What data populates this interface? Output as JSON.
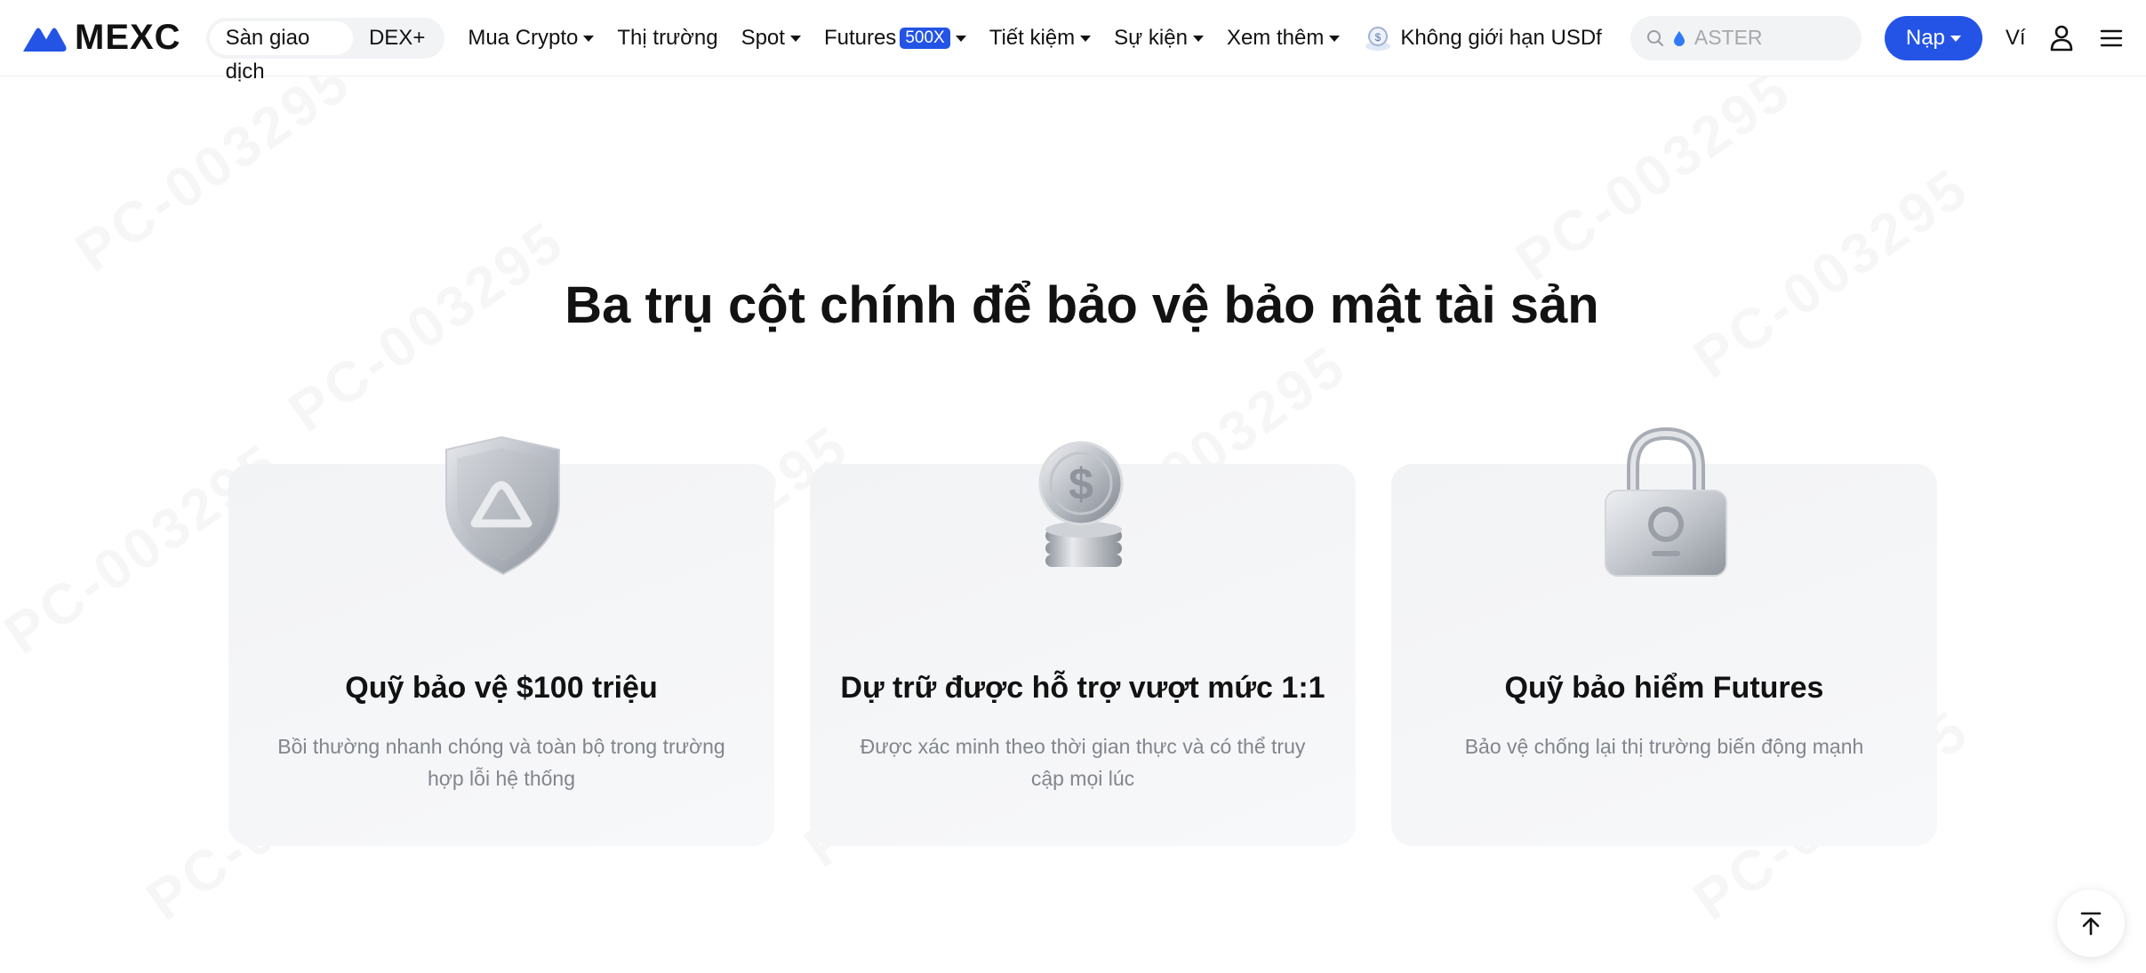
{
  "brand": {
    "name": "MEXC"
  },
  "segment": [
    {
      "label": "Sàn giao dịch",
      "active": true
    },
    {
      "label": "DEX+",
      "active": false
    }
  ],
  "nav": {
    "buy_crypto": "Mua Crypto",
    "markets": "Thị trường",
    "spot": "Spot",
    "futures": "Futures",
    "futures_badge": "500X",
    "earn": "Tiết kiệm",
    "events": "Sự kiện",
    "more": "Xem thêm",
    "promo": "Không giới hạn USDf"
  },
  "search": {
    "placeholder": "ASTER"
  },
  "actions": {
    "deposit": "Nạp",
    "wallet": "Ví"
  },
  "watermark": "PC-003295",
  "section": {
    "title": "Ba trụ cột chính để bảo vệ bảo mật tài sản",
    "cards": [
      {
        "title": "Quỹ bảo vệ $100 triệu",
        "desc": "Bồi thường nhanh chóng và toàn bộ trong trường hợp lỗi hệ thống",
        "icon": "shield-icon"
      },
      {
        "title": "Dự trữ được hỗ trợ vượt mức 1:1",
        "desc": "Được xác minh theo thời gian thực và có thể truy cập mọi lúc",
        "icon": "coins-icon"
      },
      {
        "title": "Quỹ bảo hiểm Futures",
        "desc": "Bảo vệ chống lại thị trường biến động mạnh",
        "icon": "lock-icon"
      }
    ]
  },
  "colors": {
    "accent": "#2354e6",
    "text": "#121212",
    "muted": "#81858c",
    "card_bg": "#f4f5f7"
  }
}
